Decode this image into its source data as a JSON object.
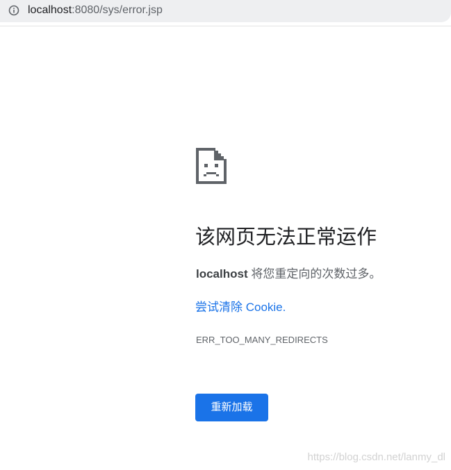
{
  "address_bar": {
    "icon": "info-icon",
    "url_host": "localhost",
    "url_rest": ":8080/sys/error.jsp"
  },
  "error": {
    "icon": "sad-page-icon",
    "headline": "该网页无法正常运作",
    "summary_host": "localhost",
    "summary_text": " 将您重定向的次数过多。",
    "link_text": "尝试清除 Cookie.",
    "error_code": "ERR_TOO_MANY_REDIRECTS",
    "reload_label": "重新加载"
  },
  "watermark": "https://blog.csdn.net/lanmy_dl",
  "colors": {
    "accent": "#1a73e8",
    "omnibox_bg": "#eeeff1",
    "text_primary": "#202124",
    "text_secondary": "#5f6368"
  }
}
